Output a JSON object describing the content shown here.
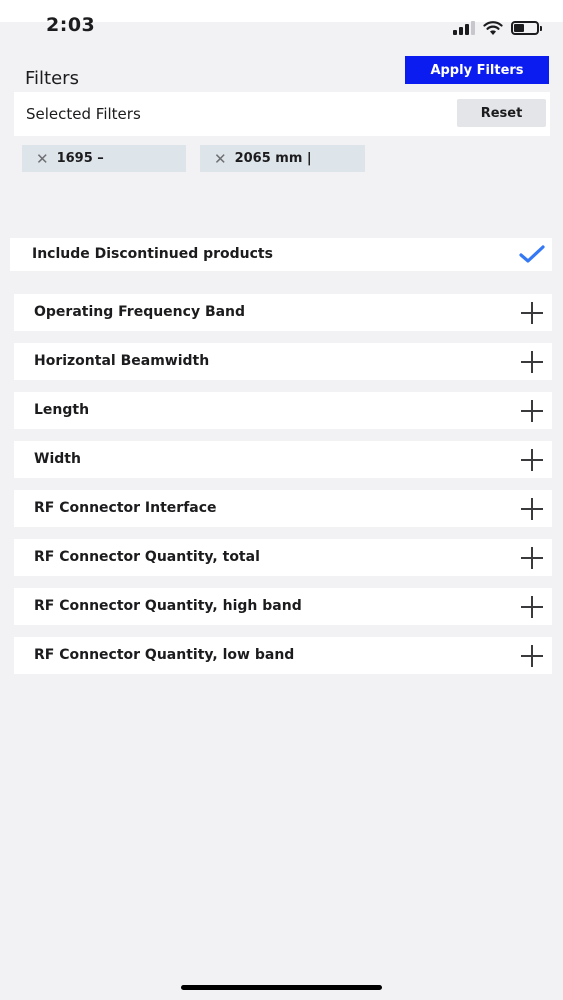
{
  "status_bar": {
    "time": "2:03",
    "battery_level": 0.45
  },
  "header": {
    "title": "Filters",
    "apply_label": "Apply Filters",
    "apply_color": "#0a1cf0"
  },
  "selected": {
    "label": "Selected Filters",
    "reset_label": "Reset",
    "chips": [
      {
        "text": "1695 –"
      },
      {
        "text": "2065 mm |"
      }
    ]
  },
  "discontinued": {
    "label": "Include Discontinued products",
    "checked": true,
    "check_color": "#3478f6"
  },
  "filters": [
    {
      "label": "Operating Frequency Band"
    },
    {
      "label": "Horizontal Beamwidth"
    },
    {
      "label": "Length"
    },
    {
      "label": "Width"
    },
    {
      "label": "RF Connector Interface"
    },
    {
      "label": "RF Connector Quantity, total"
    },
    {
      "label": "RF Connector Quantity, high band"
    },
    {
      "label": "RF Connector Quantity, low band"
    }
  ]
}
